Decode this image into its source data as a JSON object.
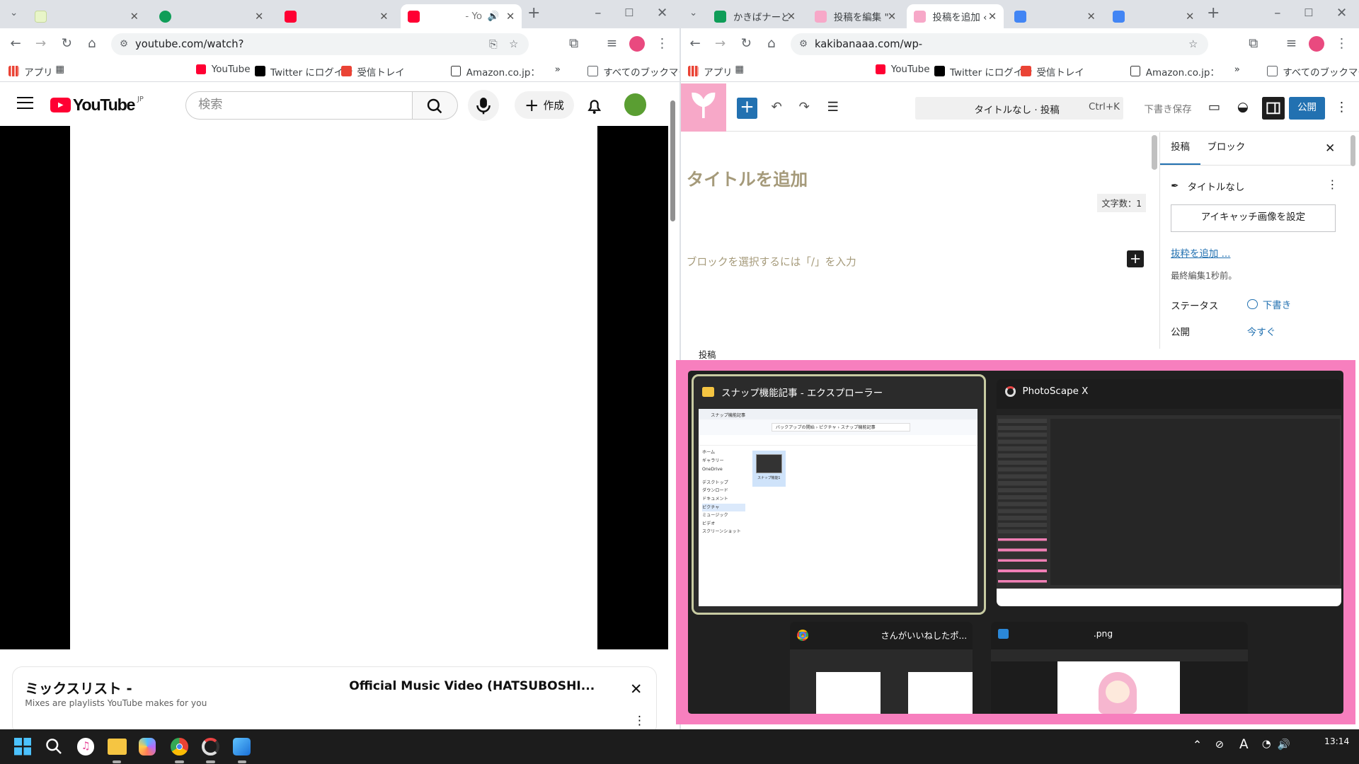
{
  "left_browser": {
    "tabs": [
      {
        "title": "",
        "favicon": "#e8f5c8"
      },
      {
        "title": "",
        "favicon": "#0f9d58"
      },
      {
        "title": "",
        "favicon": "#ff0033"
      },
      {
        "title": "- Yo",
        "favicon": "#ff0033"
      }
    ],
    "url": "youtube.com/watch?",
    "bookmarks": {
      "apps": "アプリ",
      "youtube": "YouTube",
      "twitter": "Twitter にログイン",
      "gmail": "受信トレイ",
      "amazon": "Amazon.co.jp：",
      "all": "すべてのブックマーク"
    }
  },
  "youtube": {
    "logo": "YouTube",
    "region": "JP",
    "search_placeholder": "検索",
    "create_label": "作成",
    "mix_title": "ミックスリスト -",
    "mix_video_title": "Official Music Video (HATSUBOSHI...",
    "mix_subtitle": "Mixes are playlists YouTube makes for you"
  },
  "right_browser": {
    "tabs": [
      {
        "title": "かきばナーどっと",
        "favicon": "#0f9d58"
      },
      {
        "title": "投稿を編集 \"",
        "favicon": "#f7a8c8"
      },
      {
        "title": "投稿を追加 ‹",
        "favicon": "#f7a8c8"
      },
      {
        "title": "",
        "favicon": "#4285f4"
      },
      {
        "title": "",
        "favicon": "#4285f4"
      }
    ],
    "url": "kakibanaaa.com/wp-",
    "bookmarks": {
      "apps": "アプリ",
      "youtube": "YouTube",
      "twitter": "Twitter にログイン",
      "gmail": "受信トレイ",
      "amazon": "Amazon.co.jp：",
      "all": "すべてのブックマーク"
    }
  },
  "wordpress": {
    "doc_title": "タイトルなし · 投稿",
    "shortcut": "Ctrl+K",
    "save_draft": "下書き保存",
    "publish": "公開",
    "title_placeholder": "タイトルを追加",
    "char_count": "文字数：1",
    "block_placeholder": "ブロックを選択するには「/」を入力",
    "sidebar": {
      "tab_post": "投稿",
      "tab_block": "ブロック",
      "post_title": "タイトルなし",
      "featured_image": "アイキャッチ画像を設定",
      "add_excerpt": "抜粋を追加 ...",
      "last_edited": "最終編集1秒前。",
      "status_label": "ステータス",
      "status_value": "下書き",
      "publish_label": "公開",
      "publish_value": "今すぐ"
    },
    "footer_label": "投稿"
  },
  "snap_assist": {
    "border_color": "#f77fbe",
    "windows": [
      {
        "title": "スナップ機能記事 - エクスプローラー"
      },
      {
        "title": "PhotoScape X"
      },
      {
        "title": "さんがいいねしたポ..."
      },
      {
        "title": ".png"
      }
    ],
    "explorer": {
      "tab": "スナップ機能記事",
      "path": [
        "バックアップの開始",
        "ピクチャ",
        "スナップ機能記事"
      ],
      "nav": [
        "ホーム",
        "ギャラリー",
        "OneDrive",
        "デスクトップ",
        "ダウンロード",
        "ドキュメント",
        "ピクチャ",
        "ミュージック",
        "ビデオ",
        "スクリーンショット"
      ],
      "file": "スナップ機能1"
    }
  },
  "taskbar": {
    "time": "13:14"
  }
}
